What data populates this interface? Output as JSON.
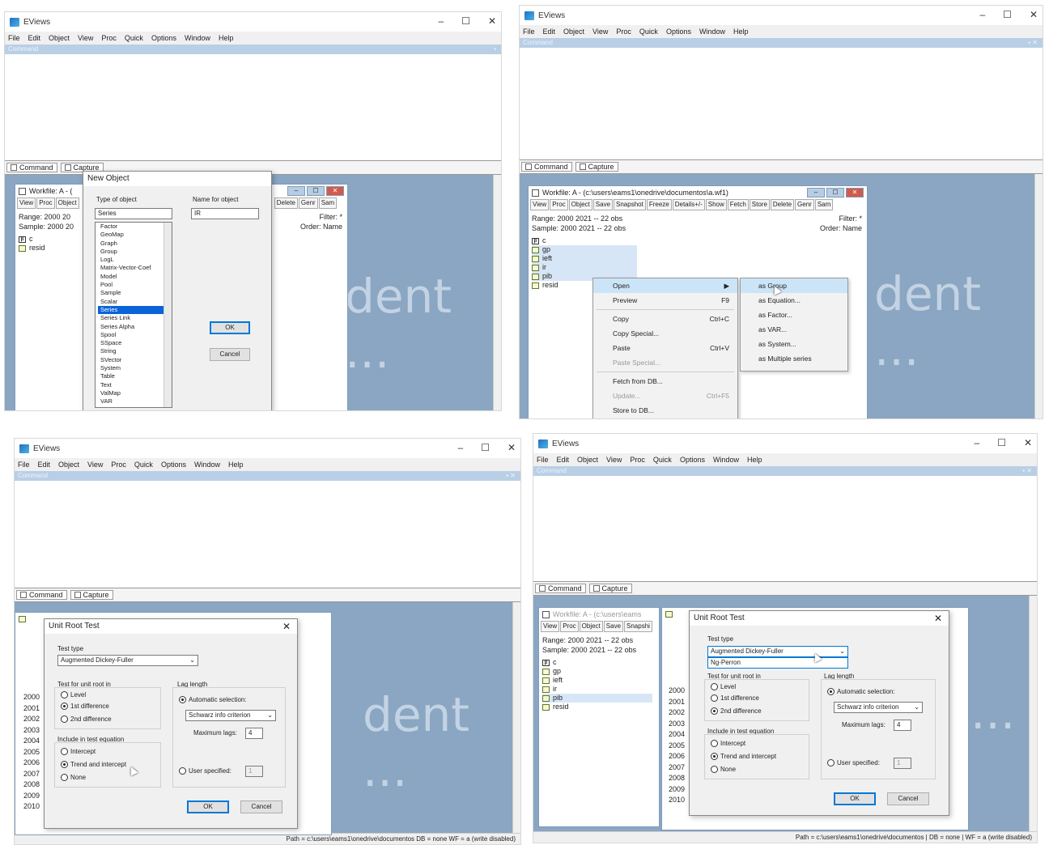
{
  "app_title": "EViews",
  "menu": [
    "File",
    "Edit",
    "Object",
    "View",
    "Proc",
    "Quick",
    "Options",
    "Window",
    "Help"
  ],
  "command_label": "Command",
  "tabs": {
    "command": "Command",
    "capture": "Capture"
  },
  "watermark": "dent ...",
  "win_controls": {
    "min": "–",
    "max": "☐",
    "close": "✕"
  },
  "workfile": {
    "title_short": "Workfile: A - (",
    "title_full": "Workfile: A - (c:\\users\\eams1\\onedrive\\documentos\\a.wf1)",
    "title_p4": "Workfile: A - (c:\\users\\eams",
    "toolbar_short": [
      "View",
      "Proc",
      "Object"
    ],
    "toolbar_short_right": [
      "Delete",
      "Genr",
      "Sam"
    ],
    "toolbar_full": [
      "View",
      "Proc",
      "Object",
      "Save",
      "Snapshot",
      "Freeze",
      "Details+/-",
      "Show",
      "Fetch",
      "Store",
      "Delete",
      "Genr",
      "Sam"
    ],
    "toolbar_p4": [
      "View",
      "Proc",
      "Object",
      "Save",
      "Snapshi"
    ],
    "range_short": "Range:  2000 20",
    "sample_short": "Sample: 2000 20",
    "range_full": "Range:  2000 2021   --  22 obs",
    "sample_full": "Sample: 2000 2021   --  22 obs",
    "range_p4": "Range:  2000 2021   --  22 obs",
    "sample_p4": "Sample: 2000 2021   --  22 obs",
    "filter": "Filter: *",
    "order": "Order: Name",
    "objects_short": [
      "c",
      "resid"
    ],
    "objects_full": [
      "c",
      "gp",
      "ieft",
      "ir",
      "pib",
      "resid"
    ]
  },
  "new_object": {
    "title": "New Object",
    "type_label": "Type of object",
    "name_label": "Name for object",
    "type_value": "Series",
    "name_value": "IR",
    "types": [
      "Factor",
      "GeoMap",
      "Graph",
      "Group",
      "LogL",
      "Matrix-Vector-Coef",
      "Model",
      "Pool",
      "Sample",
      "Scalar",
      "Series",
      "Series Link",
      "Series Alpha",
      "Spool",
      "SSpace",
      "String",
      "SVector",
      "System",
      "Table",
      "Text",
      "ValMap",
      "VAR"
    ],
    "selected_type": "Series",
    "ok": "OK",
    "cancel": "Cancel"
  },
  "context_menu": {
    "items": [
      {
        "label": "Open",
        "shortcut": "",
        "disabled": false
      },
      {
        "label": "Preview",
        "shortcut": "F9",
        "disabled": false
      },
      {
        "label": "Copy",
        "shortcut": "Ctrl+C",
        "disabled": false
      },
      {
        "label": "Copy Special...",
        "shortcut": "",
        "disabled": false
      },
      {
        "label": "Paste",
        "shortcut": "Ctrl+V",
        "disabled": false
      },
      {
        "label": "Paste Special...",
        "shortcut": "",
        "disabled": true
      },
      {
        "label": "Fetch from DB...",
        "shortcut": "",
        "disabled": false
      },
      {
        "label": "Update...",
        "shortcut": "Ctrl+F5",
        "disabled": true
      },
      {
        "label": "Store to DB...",
        "shortcut": "",
        "disabled": false
      }
    ],
    "submenu": [
      "as Group",
      "as Equation...",
      "as Factor...",
      "as VAR...",
      "as System...",
      "as Multiple series"
    ]
  },
  "unit_root": {
    "title": "Unit Root Test",
    "test_type_label": "Test type",
    "test_type_value": "Augmented Dickey-Fuller",
    "test_type_option2": "Ng-Perron",
    "unit_root_label": "Test for unit root in",
    "unit_root_options": [
      "Level",
      "1st difference",
      "2nd difference"
    ],
    "include_label": "Include in test equation",
    "include_options": [
      "Intercept",
      "Trend and intercept",
      "None"
    ],
    "lag_label": "Lag length",
    "auto_label": "Automatic selection:",
    "criterion": "Schwarz info criterion",
    "max_lags_label": "Maximum lags:",
    "max_lags": "4",
    "user_label": "User specified:",
    "user_value": "1",
    "ok": "OK",
    "cancel": "Cancel"
  },
  "years": [
    "2000",
    "2001",
    "2002",
    "2003",
    "2004",
    "2005",
    "2006",
    "2007",
    "2008",
    "2009",
    "2010"
  ],
  "status": {
    "p3": "Path = c:\\users\\eams1\\onedrive\\documentos    DB = none    WF = a (write disabled)",
    "p4": "Path = c:\\users\\eams1\\onedrive\\documentos  |  DB = none  |  WF = a (write disabled)"
  },
  "colors": {
    "desktop": "#8aa6c2",
    "command_bar": "#b9cfe6",
    "selection": "#0a64d8"
  }
}
